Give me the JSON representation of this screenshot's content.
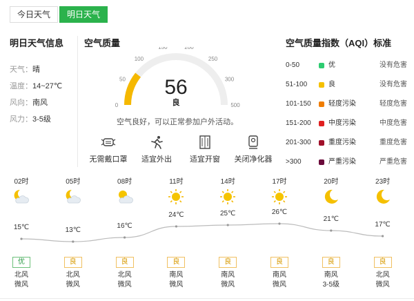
{
  "tabs": [
    {
      "label": "今日天气",
      "active": false
    },
    {
      "label": "明日天气",
      "active": true
    }
  ],
  "info": {
    "title": "明日天气信息",
    "rows": [
      {
        "key": "天气：",
        "value": "晴"
      },
      {
        "key": "温度：",
        "value": "14~27℃"
      },
      {
        "key": "风向：",
        "value": "南风"
      },
      {
        "key": "风力：",
        "value": "3-5级"
      }
    ]
  },
  "aqi": {
    "title": "空气质量",
    "value": "56",
    "level": "良",
    "fraction": 0.112,
    "scale_ticks": [
      "0",
      "50",
      "100",
      "150",
      "200",
      "250",
      "300",
      "500"
    ],
    "description": "空气良好，可以正常参加户外活动。",
    "advice": [
      {
        "label": "无需戴口罩",
        "icon": "mask-icon"
      },
      {
        "label": "适宜外出",
        "icon": "running-person-icon"
      },
      {
        "label": "适宜开窗",
        "icon": "window-icon"
      },
      {
        "label": "关闭净化器",
        "icon": "air-purifier-icon"
      }
    ],
    "colors": {
      "accent": "#f5b800",
      "track": "#eeeeee"
    }
  },
  "legend": {
    "title": "空气质量指数（AQI）标准",
    "rows": [
      {
        "range": "0-50",
        "level": "优",
        "effect": "没有危害",
        "color": "#2ecc71"
      },
      {
        "range": "51-100",
        "level": "良",
        "effect": "没有危害",
        "color": "#f5c000"
      },
      {
        "range": "101-150",
        "level": "轻度污染",
        "effect": "轻度危害",
        "color": "#f07d00"
      },
      {
        "range": "151-200",
        "level": "中度污染",
        "effect": "中度危害",
        "color": "#e02020"
      },
      {
        "range": "201-300",
        "level": "重度污染",
        "effect": "重度危害",
        "color": "#a0102a"
      },
      {
        "range": ">300",
        "level": "严重污染",
        "effect": "严重危害",
        "color": "#6a0a3a"
      }
    ]
  },
  "hourly": [
    {
      "time": "02时",
      "icon": "moon-cloud-icon",
      "temp": 15,
      "temp_label": "15℃",
      "aqi": "优",
      "wind_dir": "北风",
      "wind_force": "微风"
    },
    {
      "time": "05时",
      "icon": "moon-cloud-icon",
      "temp": 13,
      "temp_label": "13℃",
      "aqi": "良",
      "wind_dir": "北风",
      "wind_force": "微风"
    },
    {
      "time": "08时",
      "icon": "sun-cloud-icon",
      "temp": 16,
      "temp_label": "16℃",
      "aqi": "良",
      "wind_dir": "北风",
      "wind_force": "微风"
    },
    {
      "time": "11时",
      "icon": "sun-icon",
      "temp": 24,
      "temp_label": "24℃",
      "aqi": "良",
      "wind_dir": "南风",
      "wind_force": "微风"
    },
    {
      "time": "14时",
      "icon": "sun-icon",
      "temp": 25,
      "temp_label": "25℃",
      "aqi": "良",
      "wind_dir": "南风",
      "wind_force": "微风"
    },
    {
      "time": "17时",
      "icon": "sun-icon",
      "temp": 26,
      "temp_label": "26℃",
      "aqi": "良",
      "wind_dir": "南风",
      "wind_force": "微风"
    },
    {
      "time": "20时",
      "icon": "moon-icon",
      "temp": 21,
      "temp_label": "21℃",
      "aqi": "良",
      "wind_dir": "南风",
      "wind_force": "3-5级"
    },
    {
      "time": "23时",
      "icon": "moon-icon",
      "temp": 17,
      "temp_label": "17℃",
      "aqi": "良",
      "wind_dir": "北风",
      "wind_force": "微风"
    }
  ]
}
